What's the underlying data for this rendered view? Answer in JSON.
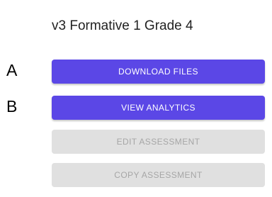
{
  "header": {
    "title": "v3 Formative 1 Grade 4"
  },
  "markers": {
    "a": "A",
    "b": "B"
  },
  "actions": {
    "download_label": "DOWNLOAD FILES",
    "analytics_label": "VIEW ANALYTICS",
    "edit_label": "EDIT ASSESSMENT",
    "copy_label": "COPY ASSESSMENT"
  },
  "colors": {
    "primary": "#5b47e6",
    "disabled_bg": "#e0e0e0",
    "disabled_text": "#a6a6a6"
  }
}
